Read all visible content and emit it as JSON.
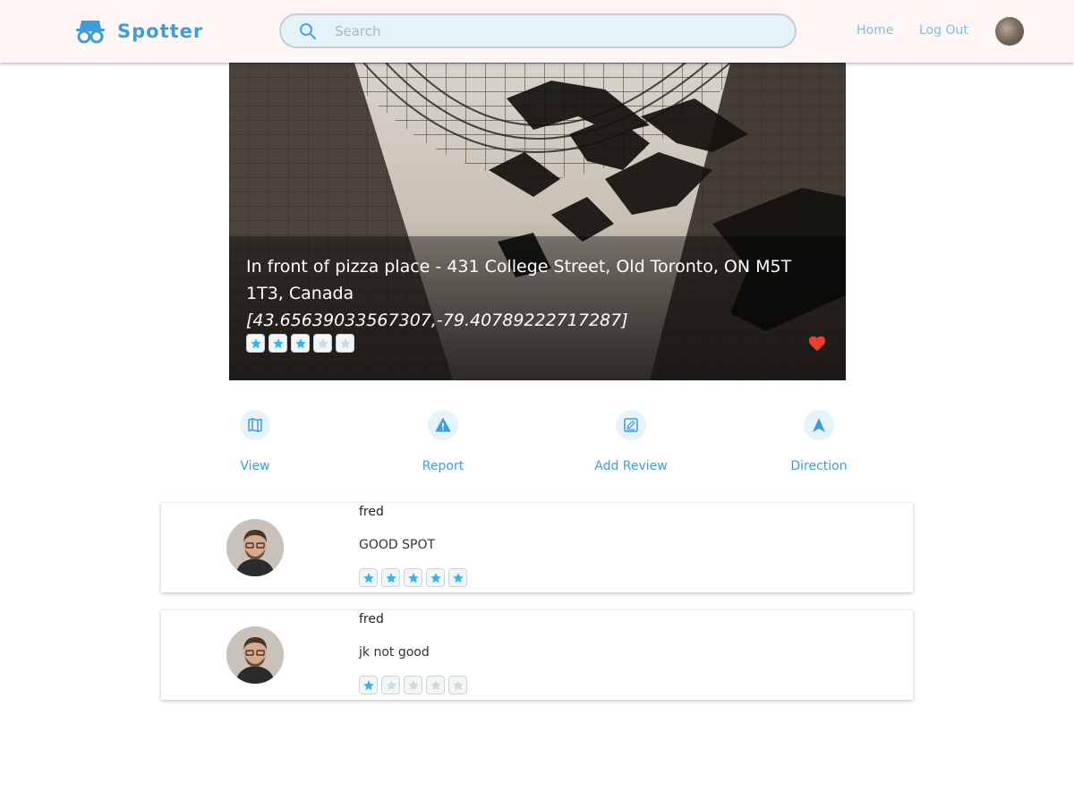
{
  "header": {
    "brand": "Spotter",
    "search_placeholder": "Search",
    "nav": {
      "home": "Home",
      "logout": "Log Out"
    }
  },
  "spot": {
    "address": "In front of pizza place - 431 College Street, Old Toronto, ON M5T 1T3, Canada",
    "coordinates": "[43.65639033567307,-79.40789222717287]",
    "rating": 3,
    "max_rating": 5,
    "favorited": true
  },
  "actions": [
    {
      "label": "View",
      "icon": "map-icon"
    },
    {
      "label": "Report",
      "icon": "warning-icon"
    },
    {
      "label": "Add Review",
      "icon": "edit-icon"
    },
    {
      "label": "Direction",
      "icon": "navigation-arrow-icon"
    }
  ],
  "reviews": [
    {
      "author": "fred",
      "text": "GOOD SPOT",
      "rating": 5
    },
    {
      "author": "fred",
      "text": "jk not good",
      "rating": 1
    }
  ],
  "colors": {
    "accent": "#3d9dd8",
    "star_filled": "#34b4ea",
    "star_empty": "#cfd8dc",
    "heart": "#e8402f",
    "header_bg": "#fdf6f4"
  }
}
